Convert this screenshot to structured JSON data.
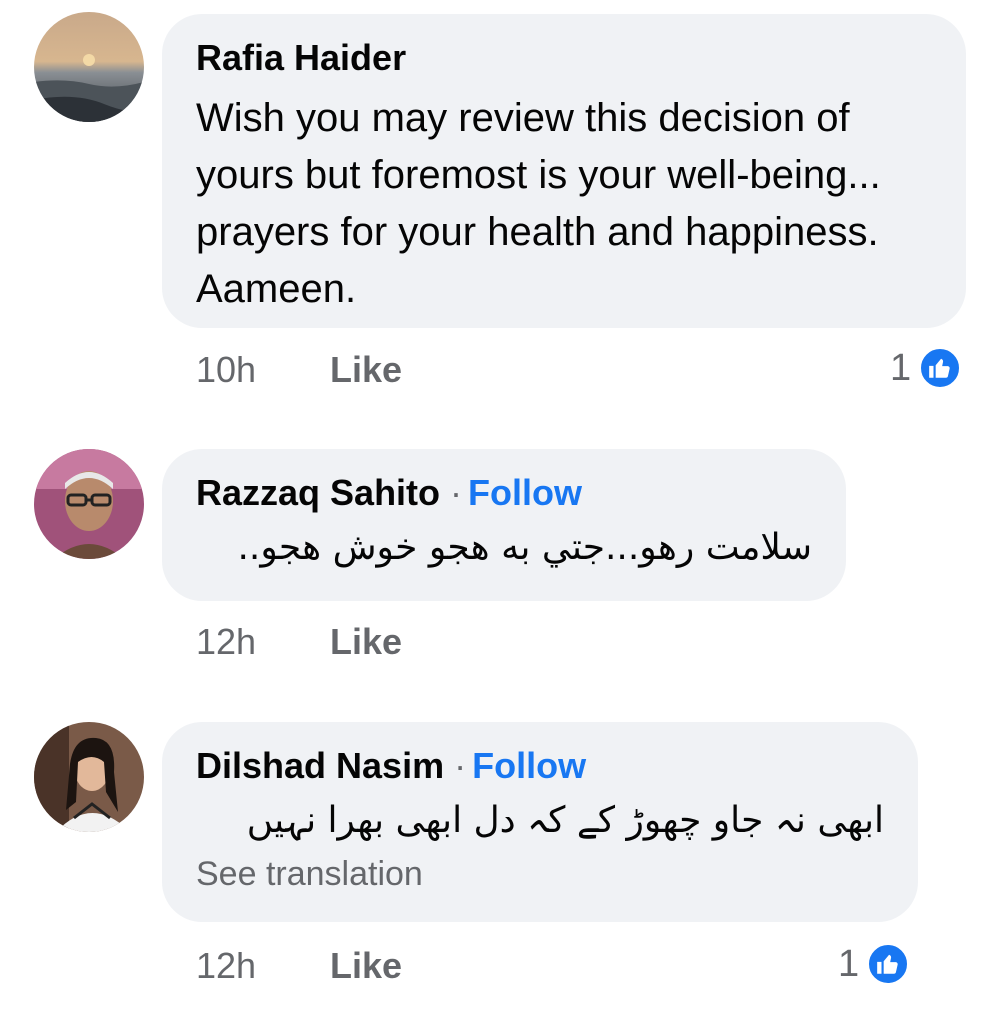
{
  "comments": [
    {
      "author": "Rafia Haider",
      "follow_label": "",
      "text": "Wish you may review this decision of yours but foremost is your well-being... prayers for your health and happiness. Aameen.",
      "time": "10h",
      "like_label": "Like",
      "reaction_count": "1",
      "avatar_icon": "sunset-avatar-icon"
    },
    {
      "author": "Razzaq Sahito",
      "follow_label": "Follow",
      "separator": "·",
      "text": "سلامت رهو...جتي به هجو خوش هجو..",
      "time": "12h",
      "like_label": "Like",
      "avatar_icon": "person-avatar-icon"
    },
    {
      "author": "Dilshad Nasim",
      "follow_label": "Follow",
      "separator": "·",
      "text": "ابھی نہ جاو چھوڑ کے کہ دل ابھی بھرا نہیں",
      "translation_label": "See translation",
      "time": "12h",
      "like_label": "Like",
      "reaction_count": "1",
      "avatar_icon": "person-avatar-icon"
    }
  ],
  "colors": {
    "bubble": "#f0f2f5",
    "accent": "#1877f2",
    "secondary_text": "#65676b"
  }
}
